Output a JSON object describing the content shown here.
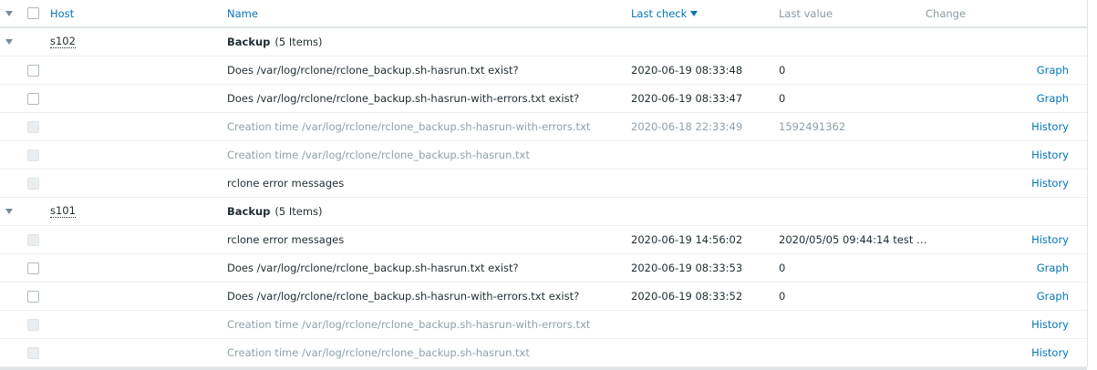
{
  "header": {
    "host": "Host",
    "name": "Name",
    "last_check": "Last check",
    "last_value": "Last value",
    "change": "Change"
  },
  "groups": [
    {
      "host": "s102",
      "app": "Backup",
      "count": "(5 Items)",
      "items": [
        {
          "name": "Does /var/log/rclone/rclone_backup.sh-hasrun.txt exist?",
          "check": "2020-06-19 08:33:48",
          "value": "0",
          "action": "Graph",
          "state": "enabled"
        },
        {
          "name": "Does /var/log/rclone/rclone_backup.sh-hasrun-with-errors.txt exist?",
          "check": "2020-06-19 08:33:47",
          "value": "0",
          "action": "Graph",
          "state": "enabled"
        },
        {
          "name": "Creation time /var/log/rclone/rclone_backup.sh-hasrun-with-errors.txt",
          "check": "2020-06-18 22:33:49",
          "value": "1592491362",
          "action": "History",
          "state": "dim"
        },
        {
          "name": "Creation time /var/log/rclone/rclone_backup.sh-hasrun.txt",
          "check": "",
          "value": "",
          "action": "History",
          "state": "dim"
        },
        {
          "name": "rclone error messages",
          "check": "",
          "value": "",
          "action": "History",
          "state": "disabled-cb"
        }
      ]
    },
    {
      "host": "s101",
      "app": "Backup",
      "count": "(5 Items)",
      "items": [
        {
          "name": "rclone error messages",
          "check": "2020-06-19 14:56:02",
          "value": "2020/05/05 09:44:14 test …",
          "action": "History",
          "state": "disabled-cb"
        },
        {
          "name": "Does /var/log/rclone/rclone_backup.sh-hasrun.txt exist?",
          "check": "2020-06-19 08:33:53",
          "value": "0",
          "action": "Graph",
          "state": "enabled"
        },
        {
          "name": "Does /var/log/rclone/rclone_backup.sh-hasrun-with-errors.txt exist?",
          "check": "2020-06-19 08:33:52",
          "value": "0",
          "action": "Graph",
          "state": "enabled"
        },
        {
          "name": "Creation time /var/log/rclone/rclone_backup.sh-hasrun-with-errors.txt",
          "check": "",
          "value": "",
          "action": "History",
          "state": "dim"
        },
        {
          "name": "Creation time /var/log/rclone/rclone_backup.sh-hasrun.txt",
          "check": "",
          "value": "",
          "action": "History",
          "state": "dim"
        }
      ]
    }
  ]
}
